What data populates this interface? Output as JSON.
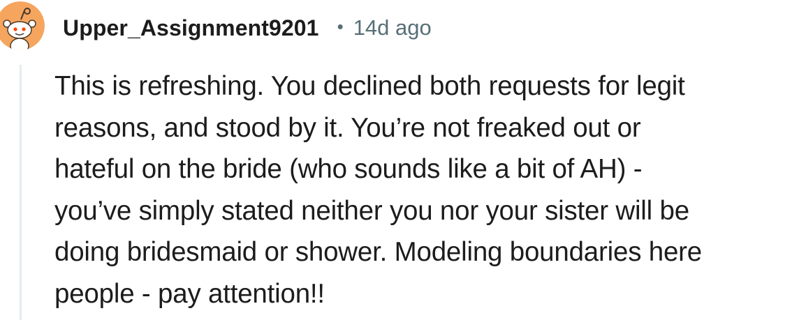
{
  "comment": {
    "username": "Upper_Assignment9201",
    "separator": "•",
    "timestamp": "14d ago",
    "body_lines": [
      "This is refreshing. You declined both requests for legit",
      "reasons, and stood by it. You’re not freaked out or",
      "hateful on the bride (who sounds like a bit of AH) -",
      "you’ve simply stated neither you nor your sister will be",
      "doing bridesmaid or shower. Modeling boundaries here",
      "people - pay attention!!"
    ]
  },
  "avatar": {
    "icon": "reddit-snoo-avatar",
    "background_color": "#f6a55f",
    "face_color": "#ffffff"
  },
  "colors": {
    "text": "#1c1c1c",
    "meta": "#576f76",
    "thread_line": "#e5ebee"
  }
}
